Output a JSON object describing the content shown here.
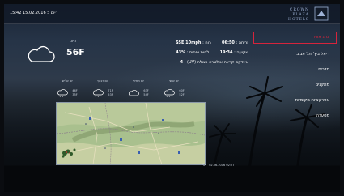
{
  "status_bar": {
    "datetime": "15:42 15.02.2016 יום ב'"
  },
  "logo": {
    "line1": "CROWN",
    "line2": "PLAZA",
    "line3": "HOTELS",
    "mark_icon": "hotel-logo-icon"
  },
  "weather": {
    "day_label": "היום",
    "temperature": "56F",
    "current_icon": "cloud-icon",
    "details": [
      {
        "label": "זריחה :",
        "value": "06:50",
        "label2": "רוח :",
        "value2": "SSE 10mph"
      },
      {
        "label": "שקיעה :",
        "value": "19:34",
        "label2": "לחות יחסית :",
        "value2": "43%"
      },
      {
        "label": "אינדקס קרינה אולטרה-סגולה (UV) :",
        "value": "4"
      }
    ],
    "forecast": [
      {
        "day": "יום שלישי",
        "high": "46F",
        "low": "35F",
        "icon": "cloud-rain-icon"
      },
      {
        "day": "יום רביעי",
        "high": "71F",
        "low": "53F",
        "icon": "cloud-rain-icon"
      },
      {
        "day": "יום חמישי",
        "high": "63F",
        "low": "54F",
        "icon": "cloud-icon"
      },
      {
        "day": "יום שישי",
        "high": "60F",
        "low": "52F",
        "icon": "cloud-rain-icon"
      }
    ],
    "updated": "02.06.2016 02:27"
  },
  "menu": {
    "items": [
      {
        "label": "מזג אוויר",
        "active": true
      },
      {
        "label": "ריאל ביץ' תל אביב"
      },
      {
        "label": "חדרים"
      },
      {
        "label": "מתקנים"
      },
      {
        "label": "אטרקציות מקומיות"
      },
      {
        "label": "מסעדה"
      }
    ]
  },
  "colors": {
    "accent": "#d6243c",
    "topbar": "#121a28"
  }
}
